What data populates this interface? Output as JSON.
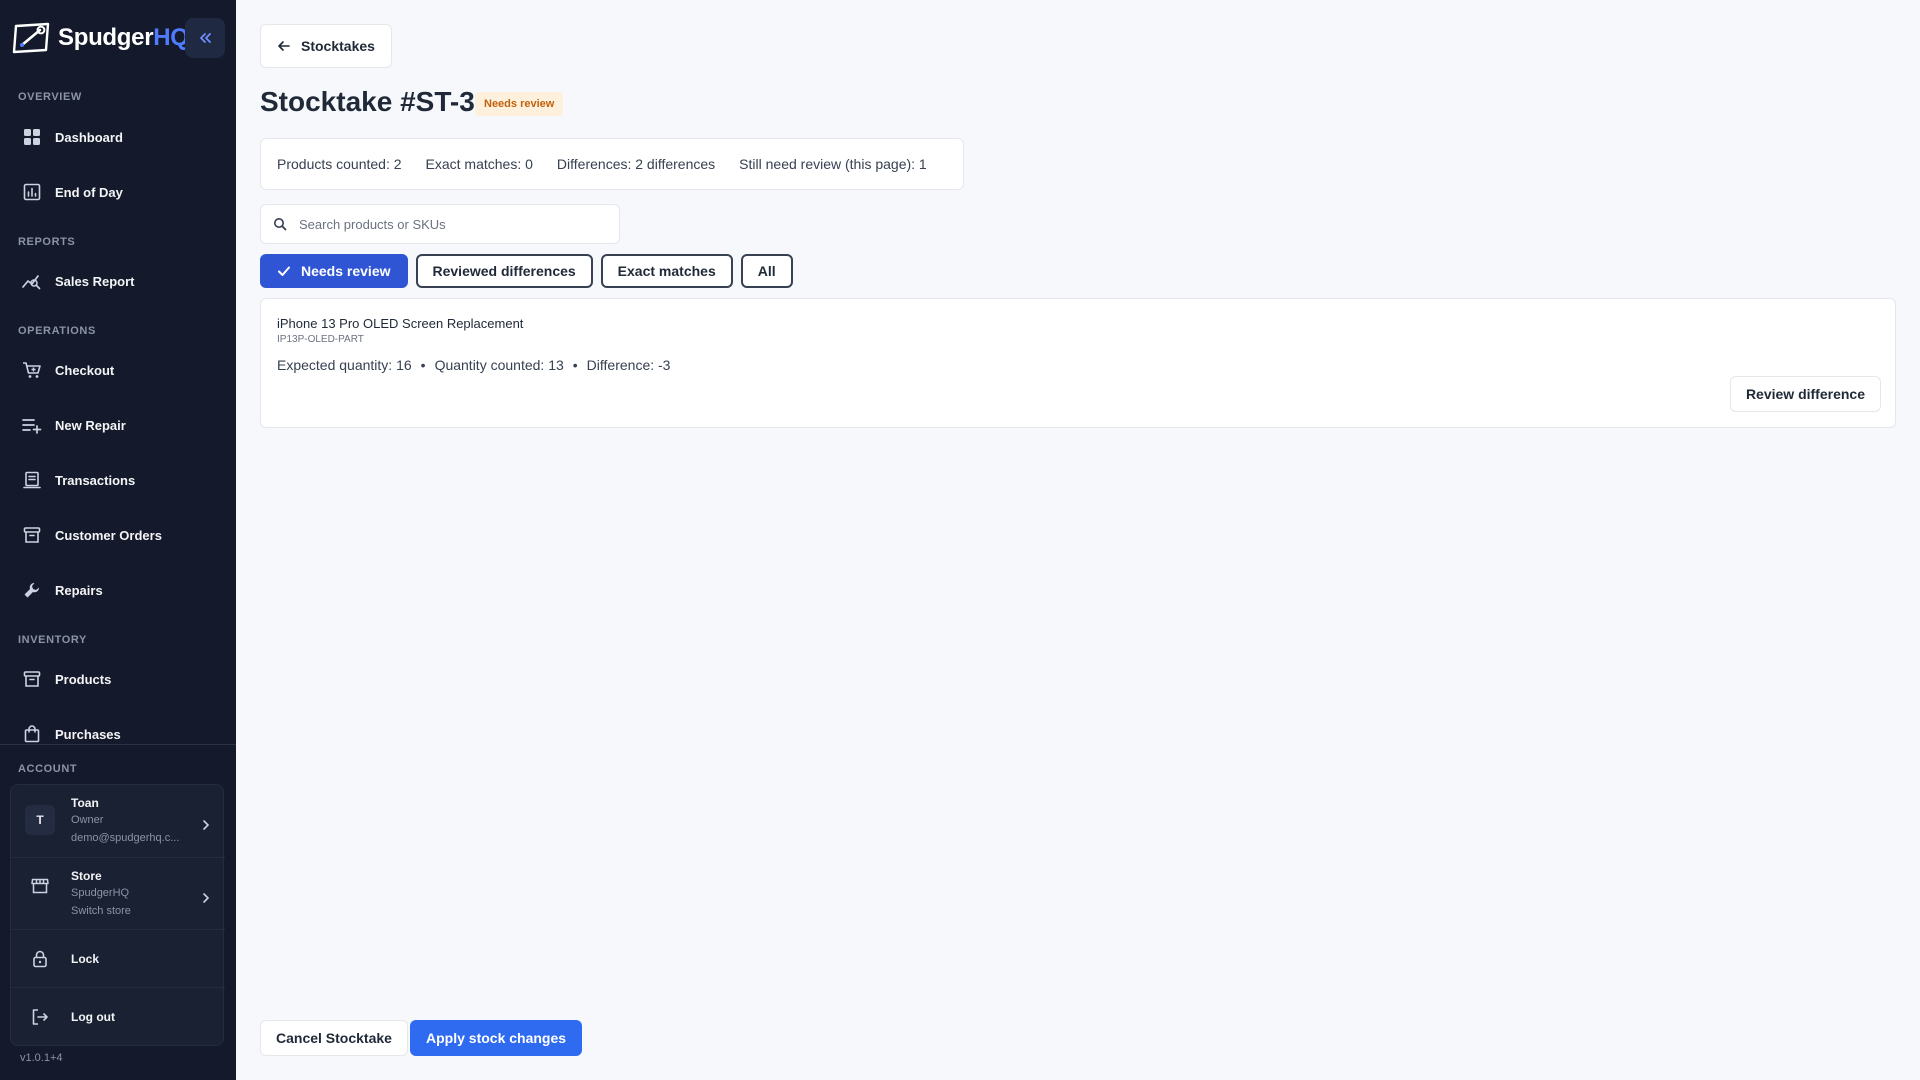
{
  "app": {
    "brand_name": "Spudger",
    "brand_suffix": "HQ",
    "brand_color": "#4f7cff",
    "version": "v1.0.1+4"
  },
  "sidebar": {
    "collapse_icon": "chevrons-left-icon",
    "sections": {
      "overview": "OVERVIEW",
      "reports": "REPORTS",
      "operations": "OPERATIONS",
      "inventory": "INVENTORY",
      "account": "ACCOUNT"
    },
    "items": {
      "dashboard": {
        "label": "Dashboard",
        "icon": "dashboard-grid-icon"
      },
      "end_of_day": {
        "label": "End of Day",
        "icon": "bar-chart-icon"
      },
      "sales_report": {
        "label": "Sales Report",
        "icon": "trend-chart-icon"
      },
      "checkout": {
        "label": "Checkout",
        "icon": "cart-icon"
      },
      "new_repair": {
        "label": "New Repair",
        "icon": "list-plus-icon"
      },
      "transactions": {
        "label": "Transactions",
        "icon": "receipt-icon"
      },
      "customer_orders": {
        "label": "Customer Orders",
        "icon": "archive-box-icon"
      },
      "repairs": {
        "label": "Repairs",
        "icon": "wrench-icon"
      },
      "products": {
        "label": "Products",
        "icon": "archive-box-icon"
      },
      "purchases": {
        "label": "Purchases",
        "icon": "shopping-bag-icon"
      }
    },
    "account": {
      "user": {
        "initial": "T",
        "name": "Toan",
        "role": "Owner",
        "email": "demo@spudgerhq.c..."
      },
      "store": {
        "title": "Store",
        "name": "SpudgerHQ",
        "action": "Switch store"
      },
      "lock_label": "Lock",
      "logout_label": "Log out"
    }
  },
  "header": {
    "back_label": "Stocktakes",
    "title": "Stocktake #ST-3",
    "status": "Needs review",
    "status_color": "#c2620d"
  },
  "stats": {
    "products_counted": "Products counted: 2",
    "exact_matches": "Exact matches: 0",
    "differences": "Differences: 2 differences",
    "still_need_review": "Still need review (this page): 1"
  },
  "search": {
    "placeholder": "Search products or SKUs",
    "value": ""
  },
  "filters": {
    "needs_review": "Needs review",
    "reviewed_differences": "Reviewed differences",
    "exact_matches": "Exact matches",
    "all": "All",
    "active": "needs_review",
    "active_color": "#2f55d4"
  },
  "items": [
    {
      "name": "iPhone 13 Pro OLED Screen Replacement",
      "sku": "IP13P-OLED-PART",
      "expected": "Expected quantity: 16",
      "counted": "Quantity counted: 13",
      "difference": "Difference: -3",
      "action": "Review difference"
    }
  ],
  "footer": {
    "cancel_label": "Cancel Stocktake",
    "apply_label": "Apply stock changes",
    "apply_color": "#2f6bf0"
  }
}
